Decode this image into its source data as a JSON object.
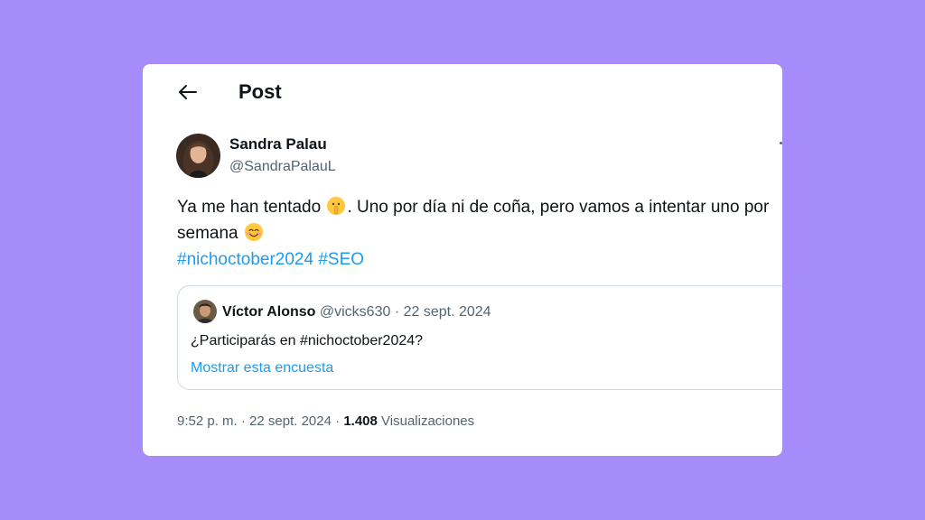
{
  "header": {
    "title": "Post"
  },
  "author": {
    "name": "Sandra Palau",
    "handle": "@SandraPalauL"
  },
  "tweet": {
    "text_part1": "Ya me han tentado ",
    "emoji1": "shushing-face-emoji",
    "text_part2": ". Uno por día ni de coña, pero vamos a intentar uno por semana ",
    "emoji2": "smiling-face-emoji",
    "hashtags": [
      "#nichoctober2024",
      "#SEO"
    ]
  },
  "quote": {
    "author_name": "Víctor Alonso",
    "author_handle": "@vicks630",
    "separator": " · ",
    "date": "22 sept. 2024",
    "text": "¿Participarás en #nichoctober2024?",
    "link_label": "Mostrar esta encuesta"
  },
  "footer": {
    "time": "9:52 p. m.",
    "date": "22 sept. 2024",
    "views_count": "1.408",
    "views_label": "Visualizaciones"
  },
  "colors": {
    "background": "#a68cfb",
    "link": "#1d9bf0",
    "secondary_text": "#536471"
  },
  "icons": {
    "back": "back-arrow-icon",
    "more": "more-options-icon"
  }
}
